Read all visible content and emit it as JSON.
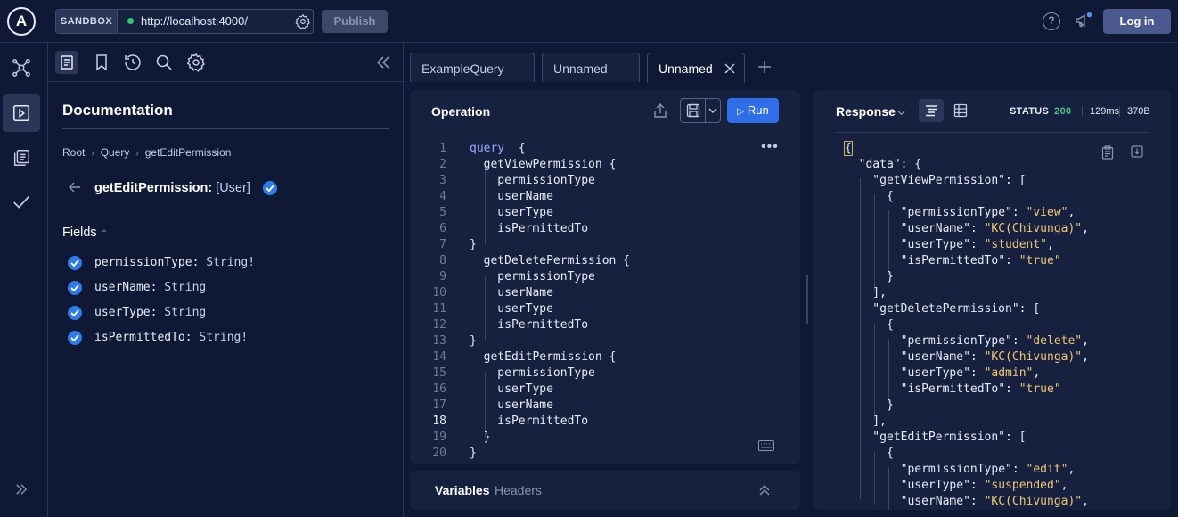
{
  "topbar": {
    "logo_letter": "A",
    "sandbox_label": "SANDBOX",
    "endpoint_url": "http://localhost:4000/",
    "publish_label": "Publish",
    "help_label": "?",
    "login_label": "Log in"
  },
  "rail": {
    "icons": [
      "schema-icon",
      "explorer-icon",
      "collections-icon",
      "checks-icon",
      "expand-icon"
    ]
  },
  "docs": {
    "title": "Documentation",
    "breadcrumb": [
      "Root",
      "Query",
      "getEditPermission"
    ],
    "field_name": "getEditPermission:",
    "field_type": "[User]",
    "fields_label": "Fields",
    "fields": [
      {
        "name": "permissionType:",
        "type": "String!"
      },
      {
        "name": "userName:",
        "type": "String"
      },
      {
        "name": "userType:",
        "type": "String"
      },
      {
        "name": "isPermittedTo:",
        "type": "String!"
      }
    ]
  },
  "tabs": [
    {
      "label": "ExampleQuery",
      "active": false
    },
    {
      "label": "Unnamed",
      "active": false
    },
    {
      "label": "Unnamed",
      "active": true
    }
  ],
  "operation": {
    "title": "Operation",
    "run_label": "Run",
    "current_line": 18,
    "lines": [
      "query  {",
      "  getViewPermission {",
      "    permissionType",
      "    userName",
      "    userType",
      "    isPermittedTo",
      "}",
      "  getDeletePermission {",
      "    permissionType",
      "    userName",
      "    userType",
      "    isPermittedTo",
      "}",
      "  getEditPermission {",
      "    permissionType",
      "    userType",
      "    userName",
      "    isPermittedTo",
      "  }",
      "}"
    ]
  },
  "variables": {
    "title": "Variables",
    "headers_label": "Headers"
  },
  "response": {
    "title": "Response",
    "status_label": "STATUS",
    "status_code": "200",
    "time": "129ms",
    "size": "370B",
    "lines": [
      "{",
      "  \"data\": {",
      "    \"getViewPermission\": [",
      "      {",
      "        \"permissionType\": \"view\",",
      "        \"userName\": \"KC(Chivunga)\",",
      "        \"userType\": \"student\",",
      "        \"isPermittedTo\": \"true\"",
      "      }",
      "    ],",
      "    \"getDeletePermission\": [",
      "      {",
      "        \"permissionType\": \"delete\",",
      "        \"userName\": \"KC(Chivunga)\",",
      "        \"userType\": \"admin\",",
      "        \"isPermittedTo\": \"true\"",
      "      }",
      "    ],",
      "    \"getEditPermission\": [",
      "      {",
      "        \"permissionType\": \"edit\",",
      "        \"userType\": \"suspended\",",
      "        \"userName\": \"KC(Chivunga)\","
    ]
  }
}
